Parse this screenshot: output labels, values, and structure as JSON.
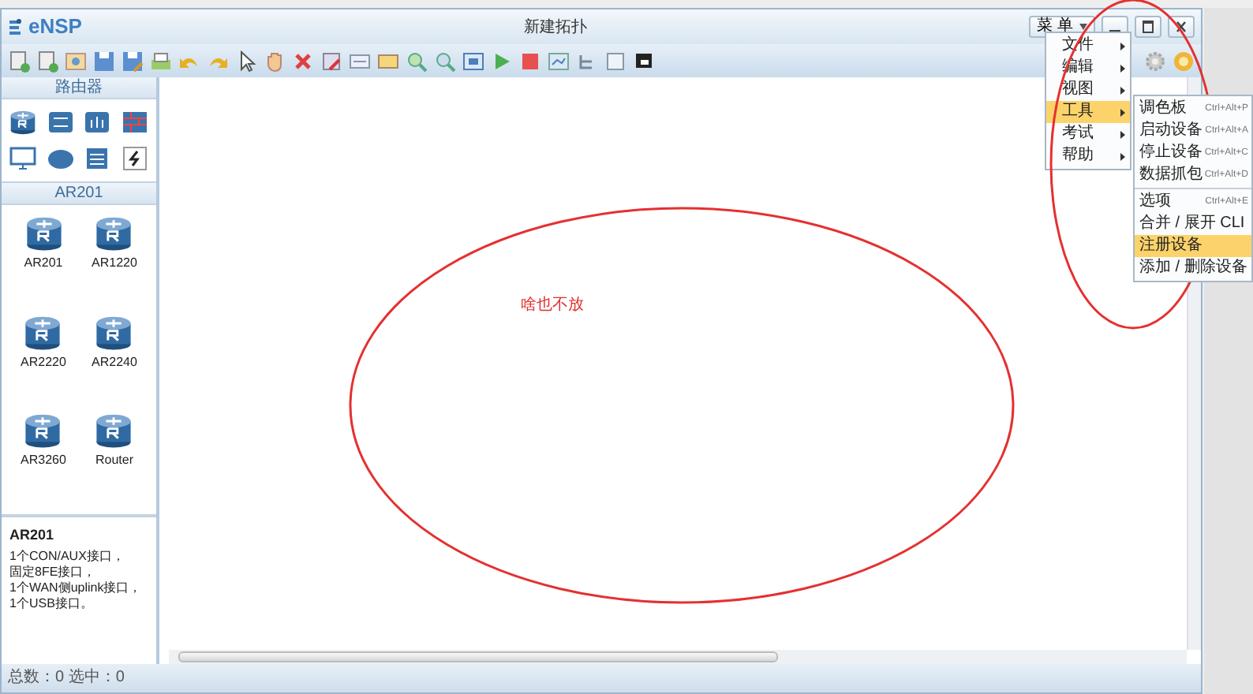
{
  "window": {
    "app_name": "eNSP",
    "title": "新建拓扑"
  },
  "title_menu": {
    "label": "菜 单"
  },
  "main_menu": [
    {
      "label": "文件",
      "selected": false
    },
    {
      "label": "编辑",
      "selected": false
    },
    {
      "label": "视图",
      "selected": false
    },
    {
      "label": "工具",
      "selected": true
    },
    {
      "label": "考试",
      "selected": false
    },
    {
      "label": "帮助",
      "selected": false
    }
  ],
  "submenu": [
    [
      {
        "label": "调色板",
        "shortcut": "Ctrl+Alt+P",
        "selected": false
      },
      {
        "label": "启动设备",
        "shortcut": "Ctrl+Alt+A",
        "selected": false
      },
      {
        "label": "停止设备",
        "shortcut": "Ctrl+Alt+C",
        "selected": false
      },
      {
        "label": "数据抓包",
        "shortcut": "Ctrl+Alt+D",
        "selected": false
      }
    ],
    [
      {
        "label": "选项",
        "shortcut": "Ctrl+Alt+E",
        "selected": false
      },
      {
        "label": "合并 / 展开 CLI",
        "selected": false
      },
      {
        "label": "注册设备",
        "selected": true
      },
      {
        "label": "添加 / 删除设备",
        "selected": false
      }
    ]
  ],
  "sidebar": {
    "category_title": "路由器",
    "device_title": "AR201",
    "devices": [
      {
        "name": "AR201"
      },
      {
        "name": "AR1220"
      },
      {
        "name": "AR2220"
      },
      {
        "name": "AR2240"
      },
      {
        "name": "AR3260"
      },
      {
        "name": "Router"
      }
    ],
    "info": {
      "title": "AR201",
      "lines": [
        "1个CON/AUX接口，",
        "固定8FE接口，",
        "1个WAN侧uplink接口，",
        "1个USB接口。"
      ]
    }
  },
  "canvas": {
    "annotation": "啥也不放"
  },
  "status_bar": {
    "text": "总数：0 选中：0"
  }
}
